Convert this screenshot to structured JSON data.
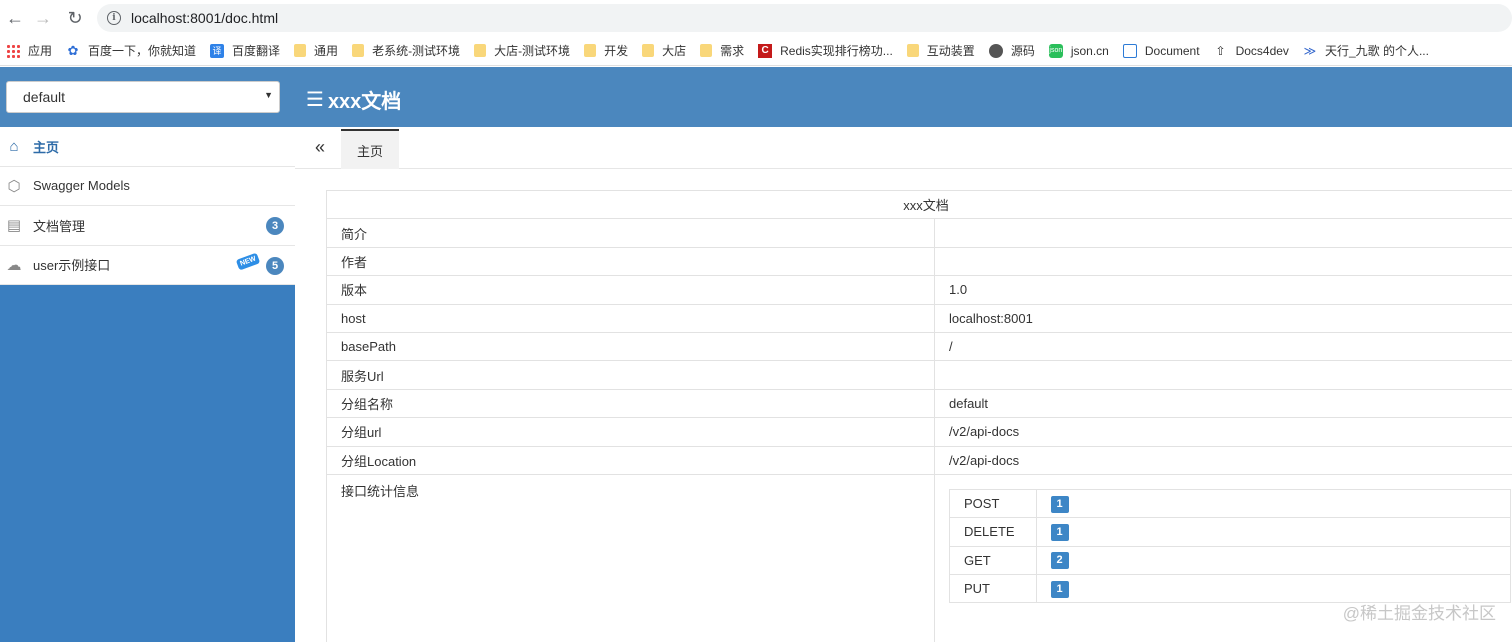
{
  "browser": {
    "url": "localhost:8001/doc.html"
  },
  "bookmarks": [
    {
      "label": "应用",
      "icon": "apps-icon"
    },
    {
      "label": "百度一下，你就知道",
      "icon": "paw-icon"
    },
    {
      "label": "百度翻译",
      "icon": "translate-icon"
    },
    {
      "label": "通用",
      "icon": "folder-icon"
    },
    {
      "label": "老系统-测试环境",
      "icon": "folder-icon"
    },
    {
      "label": "大店-测试环境",
      "icon": "folder-icon"
    },
    {
      "label": "开发",
      "icon": "folder-icon"
    },
    {
      "label": "大店",
      "icon": "folder-icon"
    },
    {
      "label": "需求",
      "icon": "folder-icon"
    },
    {
      "label": "Redis实现排行榜功...",
      "icon": "csdn-icon"
    },
    {
      "label": "互动装置",
      "icon": "folder-icon"
    },
    {
      "label": "源码",
      "icon": "globe-icon"
    },
    {
      "label": "json.cn",
      "icon": "json-icon"
    },
    {
      "label": "Document",
      "icon": "document-icon"
    },
    {
      "label": "Docs4dev",
      "icon": "docs4dev-icon"
    },
    {
      "label": "天行_九歌 的个人...",
      "icon": "tianxing-icon"
    }
  ],
  "header": {
    "group_select": "default",
    "title": "xxx文档"
  },
  "sidebar": {
    "items": [
      {
        "label": "主页",
        "badge": ""
      },
      {
        "label": "Swagger Models",
        "badge": ""
      },
      {
        "label": "文档管理",
        "badge": "3"
      },
      {
        "label": "user示例接口",
        "badge": "5",
        "tag": "NEW"
      }
    ]
  },
  "tabs": {
    "active": "主页"
  },
  "doc": {
    "title": "xxx文档",
    "rows": [
      {
        "key": "简介",
        "value": ""
      },
      {
        "key": "作者",
        "value": ""
      },
      {
        "key": "版本",
        "value": "1.0"
      },
      {
        "key": "host",
        "value": "localhost:8001"
      },
      {
        "key": "basePath",
        "value": "/"
      },
      {
        "key": "服务Url",
        "value": ""
      },
      {
        "key": "分组名称",
        "value": "default"
      },
      {
        "key": "分组url",
        "value": "/v2/api-docs"
      },
      {
        "key": "分组Location",
        "value": "/v2/api-docs"
      }
    ],
    "stats_label": "接口统计信息",
    "stats": [
      {
        "method": "POST",
        "count": "1"
      },
      {
        "method": "DELETE",
        "count": "1"
      },
      {
        "method": "GET",
        "count": "2"
      },
      {
        "method": "PUT",
        "count": "1"
      }
    ]
  },
  "watermark": "@稀土掘金技术社区"
}
